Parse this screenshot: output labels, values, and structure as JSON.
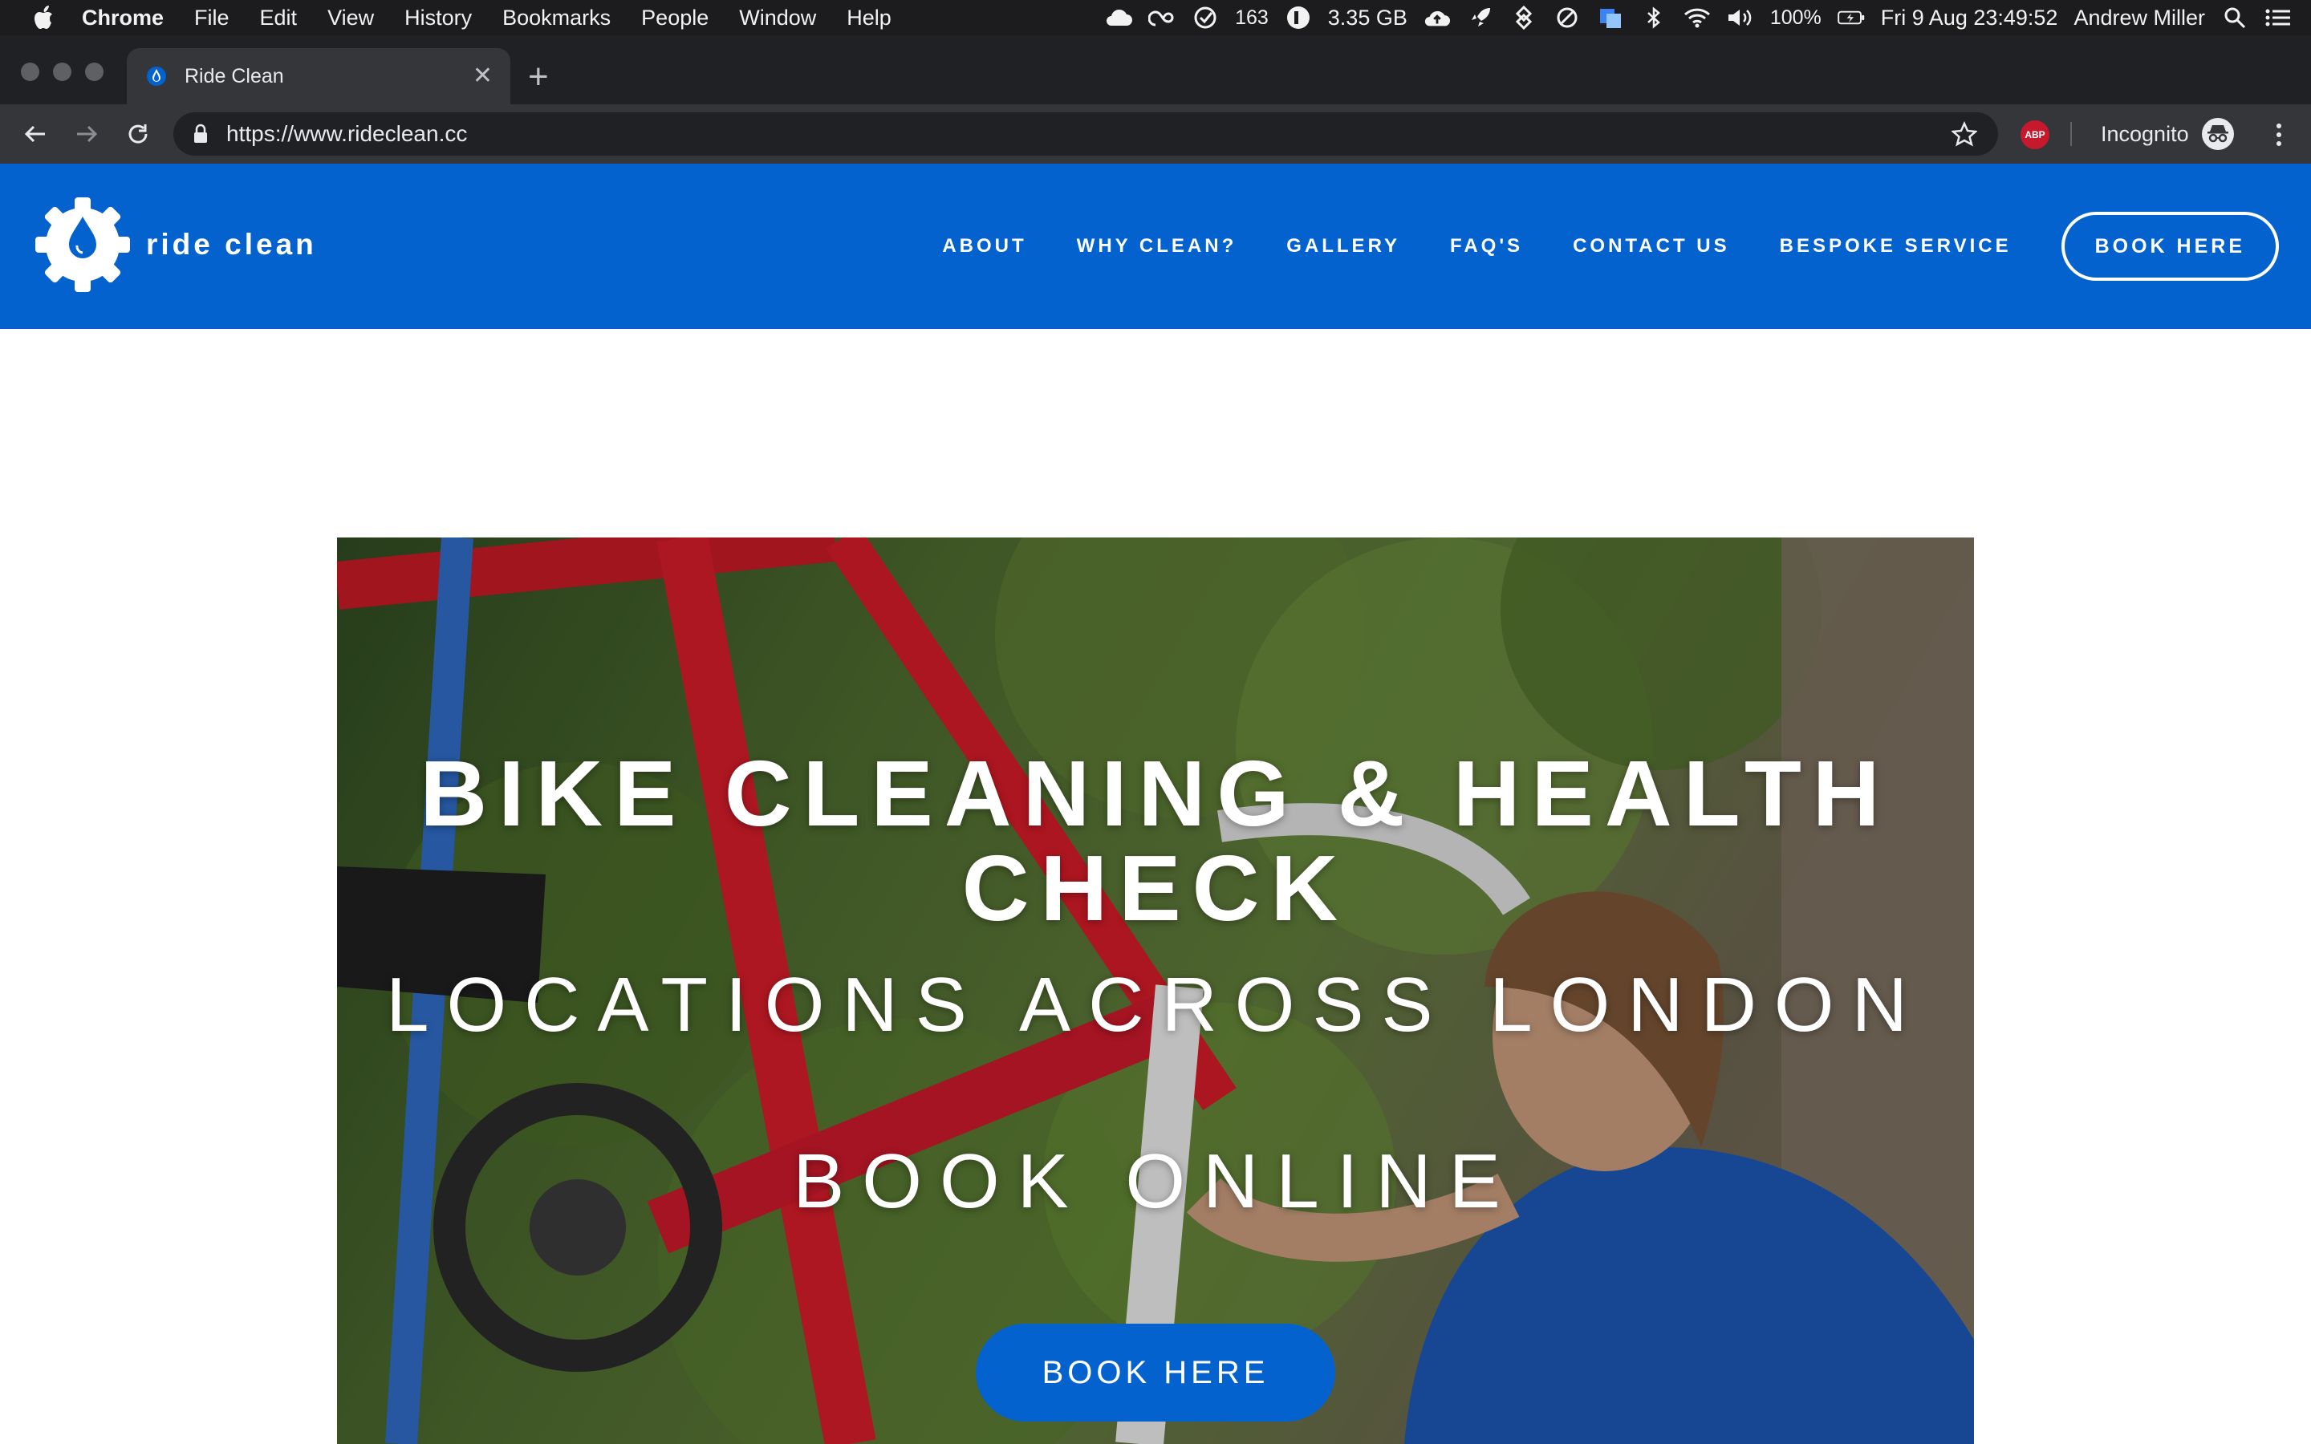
{
  "menubar": {
    "app": "Chrome",
    "items": [
      "File",
      "Edit",
      "View",
      "History",
      "Bookmarks",
      "People",
      "Window",
      "Help"
    ],
    "status": {
      "counter": "163",
      "memory": "3.35 GB",
      "battery": "100%",
      "datetime": "Fri 9 Aug  23:49:52",
      "user": "Andrew Miller"
    }
  },
  "browser": {
    "tab_title": "Ride Clean",
    "url": "https://www.rideclean.cc",
    "abp_label": "ABP",
    "incognito_label": "Incognito"
  },
  "site": {
    "logo_text": "ride clean",
    "nav": [
      "ABOUT",
      "WHY CLEAN?",
      "GALLERY",
      "FAQ'S",
      "CONTACT US",
      "BESPOKE SERVICE"
    ],
    "nav_cta": "BOOK HERE",
    "brand_color": "#0462cf"
  },
  "hero": {
    "title": "BIKE CLEANING & HEALTH CHECK",
    "subtitle": "LOCATIONS ACROSS LONDON",
    "book_online": "BOOK ONLINE",
    "button": "BOOK HERE"
  }
}
